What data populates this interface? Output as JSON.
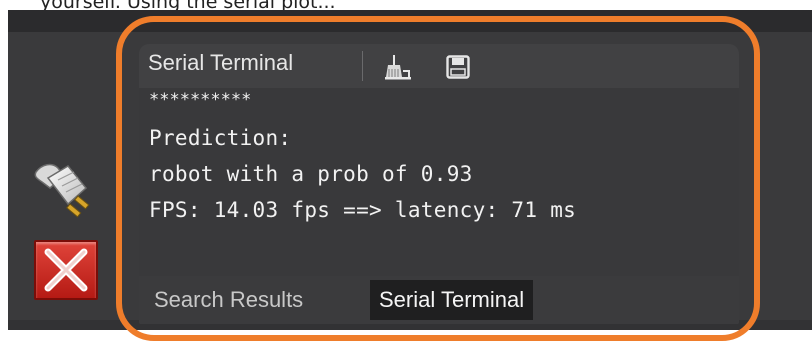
{
  "caption": {
    "text": "yourself. Using the serial plot..."
  },
  "toolbar": {
    "title": "Serial Terminal",
    "clear_icon": "broom-clear-icon",
    "save_icon": "floppy-save-icon"
  },
  "sidebar": {
    "connect_icon": "power-plug-icon",
    "disconnect_icon": "red-x-close-icon"
  },
  "terminal": {
    "lines": [
      "**********",
      "Prediction:",
      "robot with a prob of 0.93",
      "FPS: 14.03 fps ==> latency: 71 ms"
    ]
  },
  "tabs": [
    {
      "label": "Search Results",
      "active": false
    },
    {
      "label": "Serial Terminal",
      "active": true
    }
  ],
  "colors": {
    "highlight": "#ef7d2b",
    "panel": "#3a3a3c",
    "terminal_bg": "#39393b",
    "active_tab_bg": "#1f1f20",
    "text": "#f2f2f2"
  }
}
